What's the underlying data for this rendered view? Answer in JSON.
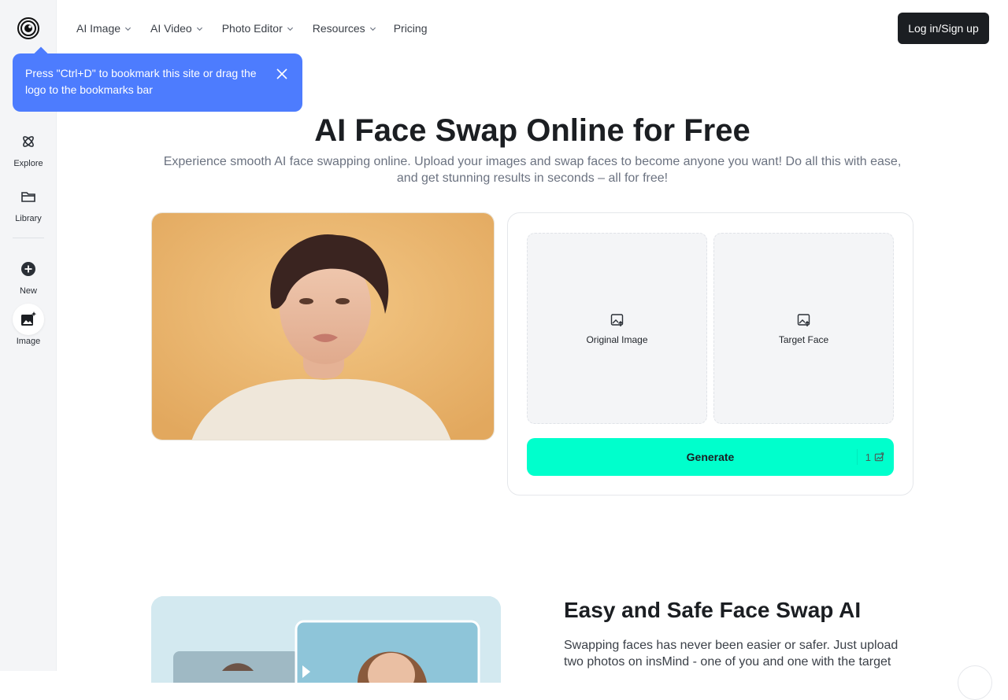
{
  "nav": {
    "items": [
      {
        "label": "AI Image"
      },
      {
        "label": "AI Video"
      },
      {
        "label": "Photo Editor"
      },
      {
        "label": "Resources"
      }
    ],
    "pricing": "Pricing",
    "login": "Log in/Sign up"
  },
  "sidebar": {
    "items": [
      {
        "label": "Explore",
        "icon": "atom-icon"
      },
      {
        "label": "Library",
        "icon": "folder-icon"
      },
      {
        "label": "New",
        "icon": "plus-circle-icon"
      },
      {
        "label": "Image",
        "icon": "image-sparkle-icon"
      }
    ]
  },
  "tooltip": {
    "text": "Press \"Ctrl+D\" to bookmark this site or drag the logo to the bookmarks bar"
  },
  "hero": {
    "title": "AI Face Swap Online for Free",
    "subtitle": "Experience smooth AI face swapping online. Upload your images and swap faces to become anyone you want! Do all this with ease, and get stunning results in seconds – all for free!"
  },
  "tool": {
    "original_label": "Original Image",
    "target_label": "Target Face",
    "generate_label": "Generate",
    "credit_cost": "1"
  },
  "section2": {
    "title": "Easy and Safe Face Swap AI",
    "text": "Swapping faces has never been easier or safer. Just upload two photos on insMind - one of you and one with the target"
  },
  "colors": {
    "accent": "#00ffcc",
    "tooltip": "#4d7cfe",
    "dark": "#1b1e22"
  }
}
